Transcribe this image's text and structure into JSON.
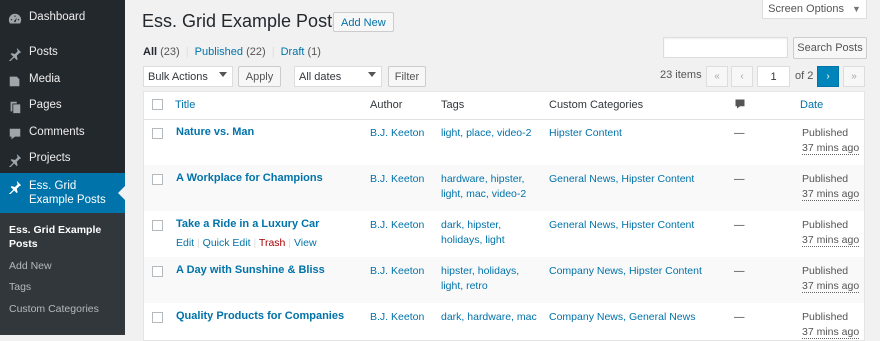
{
  "sidebar": {
    "items": [
      {
        "label": "Dashboard",
        "icon": "dashboard-icon"
      },
      {
        "label": "Posts",
        "icon": "pin-icon"
      },
      {
        "label": "Media",
        "icon": "media-icon"
      },
      {
        "label": "Pages",
        "icon": "pages-icon"
      },
      {
        "label": "Comments",
        "icon": "comment-icon"
      },
      {
        "label": "Projects",
        "icon": "pin-icon"
      },
      {
        "label": "Ess. Grid Example Posts",
        "icon": "pin-icon"
      }
    ],
    "submenu": [
      "Ess. Grid Example Posts",
      "Add New",
      "Tags",
      "Custom Categories"
    ]
  },
  "header": {
    "title": "Ess. Grid Example Posts",
    "add_new": "Add New",
    "screen_options": "Screen Options"
  },
  "views": {
    "all": "All",
    "all_count": "(23)",
    "published": "Published",
    "published_count": "(22)",
    "draft": "Draft",
    "draft_count": "(1)",
    "separator": "|"
  },
  "search": {
    "button": "Search Posts",
    "value": ""
  },
  "filters": {
    "bulk_actions": "Bulk Actions",
    "apply": "Apply",
    "dates": "All dates",
    "filter": "Filter"
  },
  "pagination": {
    "items": "23 items",
    "first": "«",
    "prev": "‹",
    "current_page": "1",
    "of": "of 2",
    "next": "›",
    "last": "»"
  },
  "table": {
    "columns": {
      "title": "Title",
      "author": "Author",
      "tags": "Tags",
      "categories": "Custom Categories",
      "comments_icon": "comment-icon",
      "date": "Date"
    },
    "rows": [
      {
        "title": "Nature vs. Man",
        "author": "B.J. Keeton",
        "tags_line1": "light, place, video-2",
        "tags_line2": "",
        "categories": "Hipster Content",
        "comments": "—",
        "status": "Published",
        "ago": "37 mins ago"
      },
      {
        "title": "A Workplace for Champions",
        "author": "B.J. Keeton",
        "tags_line1": "hardware, hipster,",
        "tags_line2": "light, mac, video-2",
        "categories": "General News, Hipster Content",
        "comments": "—",
        "status": "Published",
        "ago": "37 mins ago"
      },
      {
        "title": "Take a Ride in a Luxury Car",
        "author": "B.J. Keeton",
        "tags_line1": "dark, hipster,",
        "tags_line2": "holidays, light",
        "categories": "General News, Hipster Content",
        "comments": "—",
        "status": "Published",
        "ago": "37 mins ago",
        "actions": {
          "edit": "Edit",
          "quick_edit": "Quick Edit",
          "trash": "Trash",
          "view": "View",
          "sep": "|"
        }
      },
      {
        "title": "A Day with Sunshine & Bliss",
        "author": "B.J. Keeton",
        "tags_line1": "hipster, holidays,",
        "tags_line2": "light, retro",
        "categories": "Company News, Hipster Content",
        "comments": "—",
        "status": "Published",
        "ago": "37 mins ago"
      },
      {
        "title": "Quality Products for Companies",
        "author": "B.J. Keeton",
        "tags_line1": "dark, hardware, mac",
        "tags_line2": "",
        "categories": "Company News, General News",
        "comments": "—",
        "status": "Published",
        "ago": "37 mins ago"
      }
    ]
  },
  "colors": {
    "accent": "#0073aa",
    "sidebar_bg": "#23282d",
    "trash": "#a00"
  }
}
